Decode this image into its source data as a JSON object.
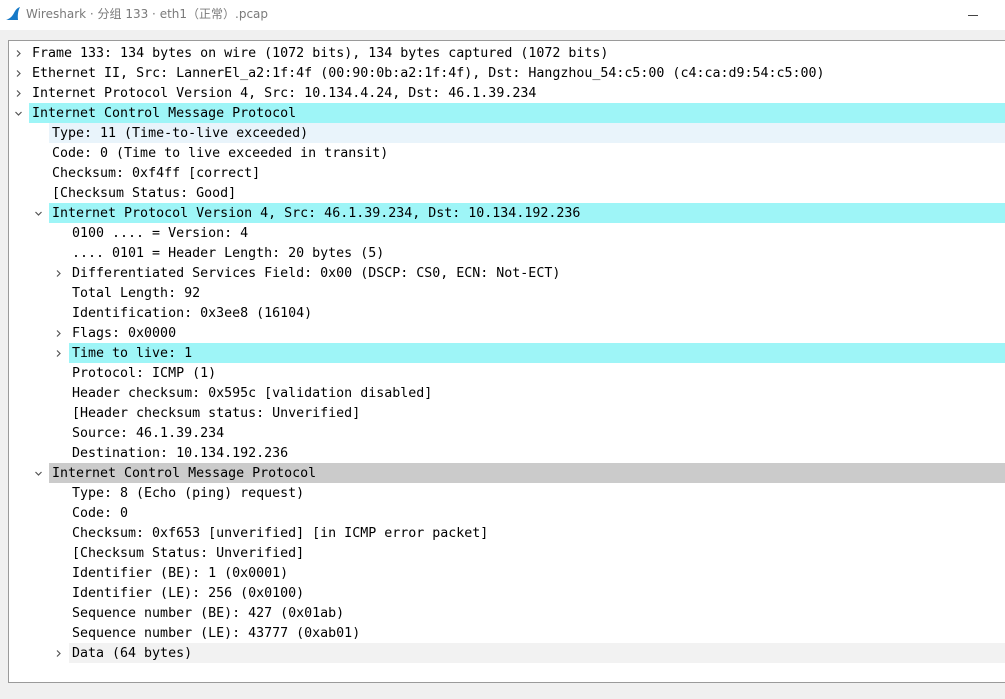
{
  "window": {
    "title": "Wireshark · 分组 133 · eth1（正常）.pcap",
    "minimize_symbol": "minimize-icon"
  },
  "tree": [
    {
      "text": "Frame 133: 134 bytes on wire (1072 bits), 134 bytes captured (1072 bits)",
      "level": 0,
      "state": "collapsed",
      "style": "none"
    },
    {
      "text": "Ethernet II, Src: LannerEl_a2:1f:4f (00:90:0b:a2:1f:4f), Dst: Hangzhou_54:c5:00 (c4:ca:d9:54:c5:00)",
      "level": 0,
      "state": "collapsed",
      "style": "none"
    },
    {
      "text": "Internet Protocol Version 4, Src: 10.134.4.24, Dst: 46.1.39.234",
      "level": 0,
      "state": "collapsed",
      "style": "none"
    },
    {
      "text": "Internet Control Message Protocol",
      "level": 0,
      "state": "expanded",
      "style": "highlight"
    },
    {
      "text": "Type: 11 (Time-to-live exceeded)",
      "level": 1,
      "state": "leaf",
      "style": "alt"
    },
    {
      "text": "Code: 0 (Time to live exceeded in transit)",
      "level": 1,
      "state": "leaf",
      "style": "none"
    },
    {
      "text": "Checksum: 0xf4ff [correct]",
      "level": 1,
      "state": "leaf",
      "style": "none"
    },
    {
      "text": "[Checksum Status: Good]",
      "level": 1,
      "state": "leaf",
      "style": "none"
    },
    {
      "text": "Internet Protocol Version 4, Src: 46.1.39.234, Dst: 10.134.192.236",
      "level": 1,
      "state": "expanded",
      "style": "highlight"
    },
    {
      "text": "0100 .... = Version: 4",
      "level": 2,
      "state": "leaf",
      "style": "none"
    },
    {
      "text": ".... 0101 = Header Length: 20 bytes (5)",
      "level": 2,
      "state": "leaf",
      "style": "none"
    },
    {
      "text": "Differentiated Services Field: 0x00 (DSCP: CS0, ECN: Not-ECT)",
      "level": 2,
      "state": "collapsed",
      "style": "none"
    },
    {
      "text": "Total Length: 92",
      "level": 2,
      "state": "leaf",
      "style": "none"
    },
    {
      "text": "Identification: 0x3ee8 (16104)",
      "level": 2,
      "state": "leaf",
      "style": "none"
    },
    {
      "text": "Flags: 0x0000",
      "level": 2,
      "state": "collapsed",
      "style": "none"
    },
    {
      "text": "Time to live: 1",
      "level": 2,
      "state": "collapsed",
      "style": "highlight"
    },
    {
      "text": "Protocol: ICMP (1)",
      "level": 2,
      "state": "leaf",
      "style": "none"
    },
    {
      "text": "Header checksum: 0x595c [validation disabled]",
      "level": 2,
      "state": "leaf",
      "style": "none"
    },
    {
      "text": "[Header checksum status: Unverified]",
      "level": 2,
      "state": "leaf",
      "style": "none"
    },
    {
      "text": "Source: 46.1.39.234",
      "level": 2,
      "state": "leaf",
      "style": "none"
    },
    {
      "text": "Destination: 10.134.192.236",
      "level": 2,
      "state": "leaf",
      "style": "none"
    },
    {
      "text": "Internet Control Message Protocol",
      "level": 1,
      "state": "expanded",
      "style": "selected"
    },
    {
      "text": "Type: 8 (Echo (ping) request)",
      "level": 2,
      "state": "leaf",
      "style": "none"
    },
    {
      "text": "Code: 0",
      "level": 2,
      "state": "leaf",
      "style": "none"
    },
    {
      "text": "Checksum: 0xf653 [unverified] [in ICMP error packet]",
      "level": 2,
      "state": "leaf",
      "style": "none"
    },
    {
      "text": "[Checksum Status: Unverified]",
      "level": 2,
      "state": "leaf",
      "style": "none"
    },
    {
      "text": "Identifier (BE): 1 (0x0001)",
      "level": 2,
      "state": "leaf",
      "style": "none"
    },
    {
      "text": "Identifier (LE): 256 (0x0100)",
      "level": 2,
      "state": "leaf",
      "style": "none"
    },
    {
      "text": "Sequence number (BE): 427 (0x01ab)",
      "level": 2,
      "state": "leaf",
      "style": "none"
    },
    {
      "text": "Sequence number (LE): 43777 (0xab01)",
      "level": 2,
      "state": "leaf",
      "style": "none"
    },
    {
      "text": "Data (64 bytes)",
      "level": 2,
      "state": "collapsed",
      "style": "light"
    }
  ],
  "colors": {
    "highlight": "#9ef5f7",
    "alt": "#e9f4fb",
    "selected": "#cbcbcb",
    "light": "#f2f2f2",
    "icon_blue": "#1679c7"
  }
}
